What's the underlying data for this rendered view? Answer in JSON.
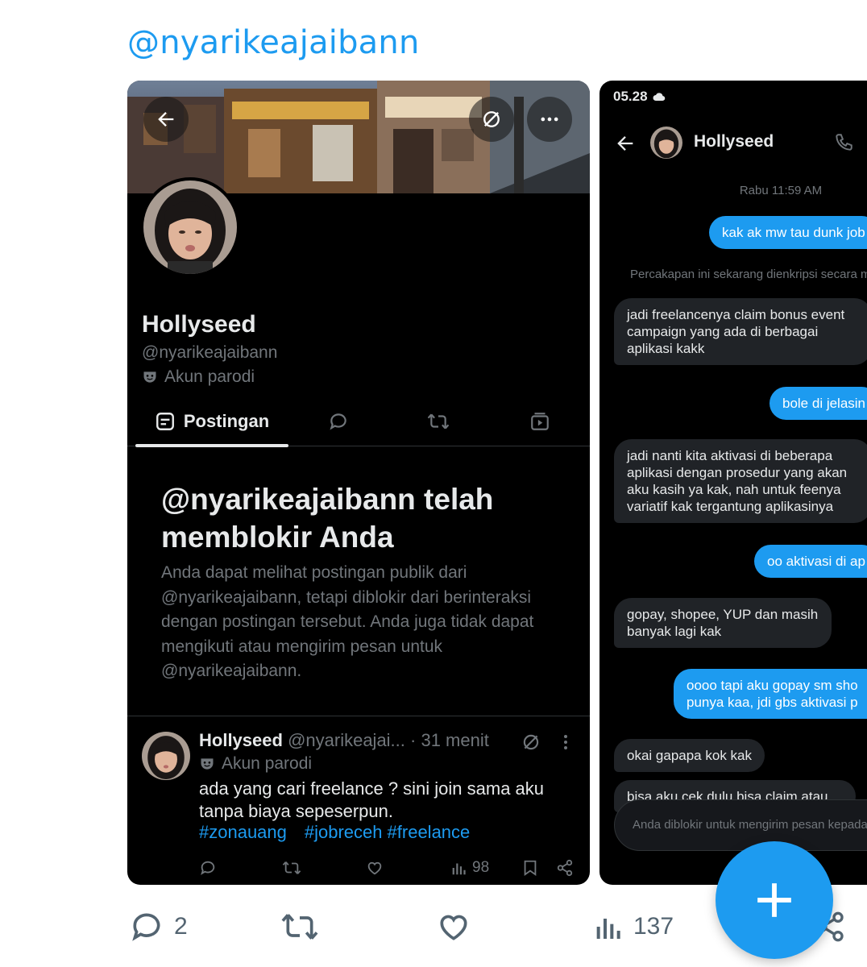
{
  "header": {
    "mention": "@nyarikeajaibann"
  },
  "profile": {
    "name": "Hollyseed",
    "handle": "@nyarikeajaibann",
    "parody_label": "Akun parodi",
    "tabs": [
      {
        "label": "Postingan",
        "icon": "posts-icon"
      },
      {
        "label": "",
        "icon": "reply-icon"
      },
      {
        "label": "",
        "icon": "repost-icon"
      },
      {
        "label": "",
        "icon": "media-icon"
      }
    ],
    "blocked_title": "@nyarikeajaibann telah memblokir Anda",
    "blocked_desc": "Anda dapat melihat postingan publik dari @nyarikeajaibann, tetapi diblokir dari berinteraksi dengan postingan tersebut. Anda juga tidak dapat mengikuti atau mengirim pesan untuk @nyarikeajaibann."
  },
  "post": {
    "name": "Hollyseed",
    "handle": "@nyarikeajai...",
    "time": "· 31 menit",
    "parody_label": "Akun parodi",
    "text": "ada yang cari freelance ? sini join sama aku tanpa biaya sepeserpun.",
    "tags": [
      "#zonauang",
      "#jobreceh",
      "#freelance"
    ],
    "views": "98"
  },
  "dm": {
    "status_time": "05.28",
    "contact_name": "Hollyseed",
    "date": "Rabu 11:59 AM",
    "messages": [
      {
        "from": "me",
        "text": "kak ak mw tau dunk job"
      },
      {
        "from": "system",
        "text": "Percakapan ini sekarang dienkripsi secara m"
      },
      {
        "from": "them",
        "text": "jadi freelancenya claim bonus event campaign yang ada di berbagai aplikasi kakk"
      },
      {
        "from": "me",
        "text": "bole di jelasin"
      },
      {
        "from": "them",
        "text": "jadi nanti kita aktivasi di beberapa aplikasi dengan prosedur yang akan aku kasih ya kak, nah untuk feenya variatif kak tergantung aplikasinya"
      },
      {
        "from": "me",
        "text": "oo aktivasi di ap"
      },
      {
        "from": "them",
        "text": "gopay, shopee, YUP dan masih banyak lagi kak"
      },
      {
        "from": "me",
        "text": "oooo tapi aku gopay sm sho punya kaa, jdi gbs aktivasi p"
      },
      {
        "from": "them",
        "text": "okai gapapa kok kak"
      },
      {
        "from": "them",
        "text": "bisa aku cek dulu bisa claim atau"
      }
    ],
    "blocked_input": "Anda diblokir untuk mengirim pesan kepada"
  },
  "bottom_actions": {
    "replies": "2",
    "views": "137"
  },
  "colors": {
    "accent": "#1d9bf0",
    "card_bg": "#000000",
    "muted": "#71767b"
  }
}
